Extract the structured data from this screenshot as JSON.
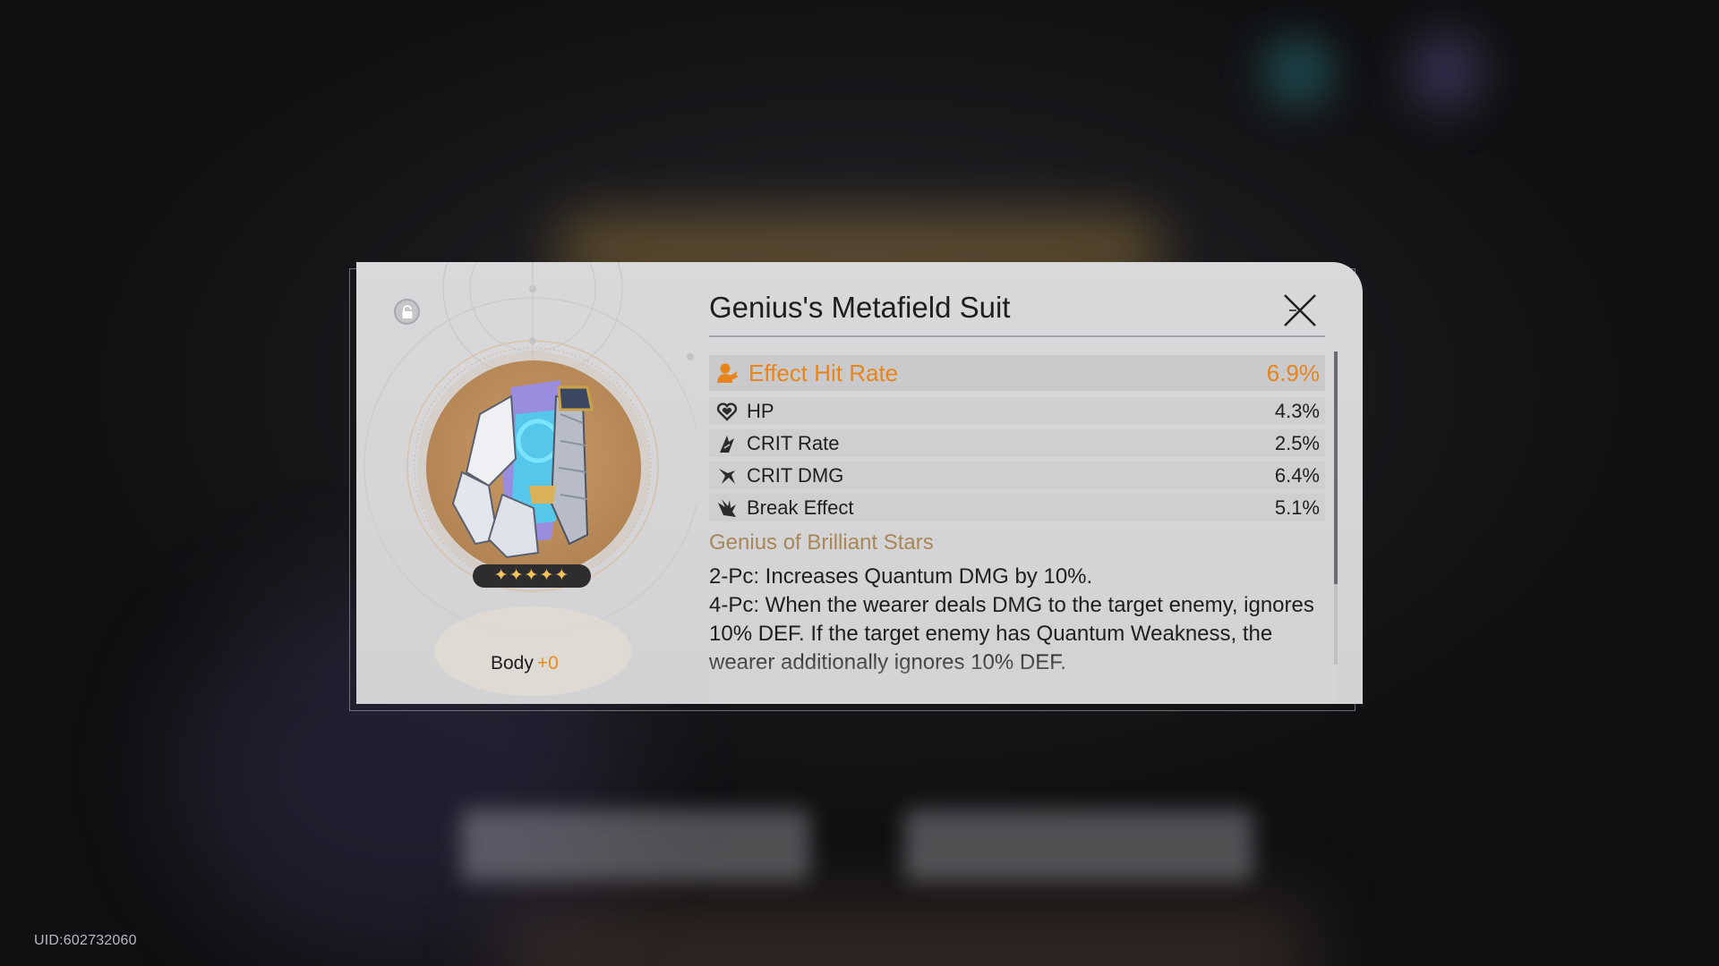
{
  "uid": "UID:602732060",
  "relic": {
    "name": "Genius's Metafield Suit",
    "slot": "Body",
    "level": "+0",
    "rarity_stars": "✦✦✦✦✦",
    "rarity": 5,
    "locked": false
  },
  "main_stat": {
    "label": "Effect Hit Rate",
    "value": "6.9%",
    "icon": "effect-hit-rate-icon"
  },
  "sub_stats": [
    {
      "label": "HP",
      "value": "4.3%",
      "icon": "hp-heart-icon"
    },
    {
      "label": "CRIT Rate",
      "value": "2.5%",
      "icon": "crit-rate-icon"
    },
    {
      "label": "CRIT DMG",
      "value": "6.4%",
      "icon": "crit-dmg-icon"
    },
    {
      "label": "Break Effect",
      "value": "5.1%",
      "icon": "break-effect-icon"
    }
  ],
  "set": {
    "name": "Genius of Brilliant Stars",
    "bonus_2": "2-Pc: Increases Quantum DMG by 10%.",
    "bonus_4": "4-Pc: When the wearer deals DMG to the target enemy, ignores 10% DEF. If the target enemy has Quantum Weakness, the wearer additionally ignores 10% DEF."
  },
  "colors": {
    "main_stat": "#e5851a",
    "set_name": "#a7865a",
    "stars": "#f2c25e",
    "level": "#e98c1f"
  }
}
